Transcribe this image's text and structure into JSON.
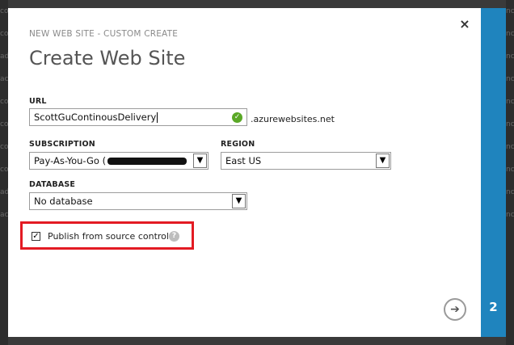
{
  "dialog": {
    "subtitle": "NEW WEB SITE - CUSTOM CREATE",
    "title": "Create Web Site",
    "close_glyph": "×",
    "step_number": "2"
  },
  "url": {
    "label": "URL",
    "value": "ScottGuContinousDelivery",
    "suffix": ".azurewebsites.net",
    "status_icon": "check-circle-icon"
  },
  "subscription": {
    "label": "SUBSCRIPTION",
    "value": "Pay-As-You-Go ("
  },
  "region": {
    "label": "REGION",
    "value": "East US"
  },
  "database": {
    "label": "DATABASE",
    "value": "No database"
  },
  "publish": {
    "label": "Publish from source control",
    "checked": true,
    "help_icon": "question-circle-icon",
    "highlight_color": "#e31b23"
  },
  "colors": {
    "accent": "#1f84be",
    "valid": "#5aa826"
  },
  "navigation": {
    "next_icon": "arrow-right-icon"
  }
}
